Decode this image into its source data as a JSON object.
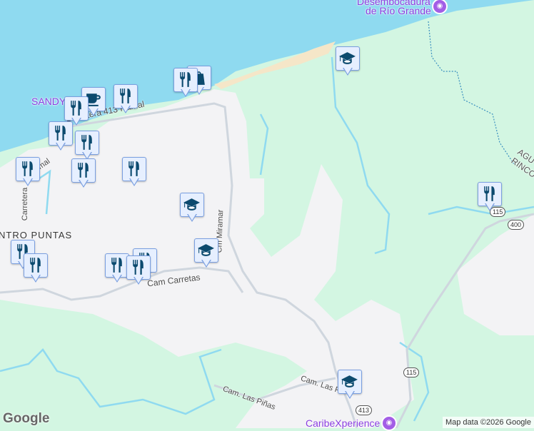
{
  "labels": {
    "poi_desembocadura_1": "Desembocadura",
    "poi_desembocadura_2": "de Río Grande",
    "poi_sandy": "SANDY",
    "poi_caribe": "CaribeXperience",
    "road_carretera_413_ramal": "Carretera 413 Ramal",
    "road_carretera_left": "Carretera",
    "road_ramal_left": "Ramal",
    "area_puntas": "NTRO PUNTAS",
    "road_cam_carretas": "Cam Carretas",
    "road_cm_miramar": "Cm Miramar",
    "road_las_pinas_1": "Cam. Las Piñas",
    "road_las_pinas_2": "Cam. Las P",
    "area_agua": "AGU",
    "area_rinco": "RINCO"
  },
  "shields": {
    "r115a": "115",
    "r400": "400",
    "r413": "413",
    "r115b": "115"
  },
  "attribution": "Map data ©2026 Google",
  "logo": "Google",
  "colors": {
    "water": "#8fdaf0",
    "land": "#d3f6e2",
    "urban": "#f3f3f5",
    "marker_icon": "#0b4a6e",
    "poi": "#8a3ee0"
  }
}
